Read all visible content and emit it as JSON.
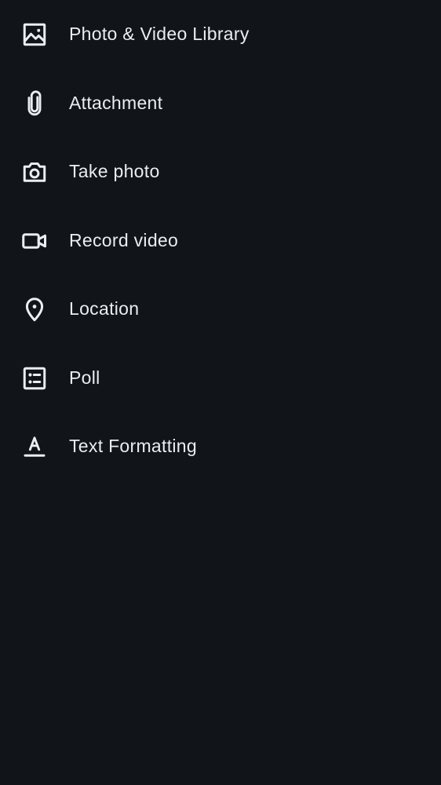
{
  "menu": {
    "items": [
      {
        "label": "Photo & Video Library",
        "icon": "photo-library-icon"
      },
      {
        "label": "Attachment",
        "icon": "paperclip-icon"
      },
      {
        "label": "Take photo",
        "icon": "camera-icon"
      },
      {
        "label": "Record video",
        "icon": "video-camera-icon"
      },
      {
        "label": "Location",
        "icon": "location-pin-icon"
      },
      {
        "label": "Poll",
        "icon": "poll-icon"
      },
      {
        "label": "Text Formatting",
        "icon": "text-format-icon"
      }
    ]
  },
  "colors": {
    "background": "#111418",
    "foreground": "#ebedf0"
  }
}
